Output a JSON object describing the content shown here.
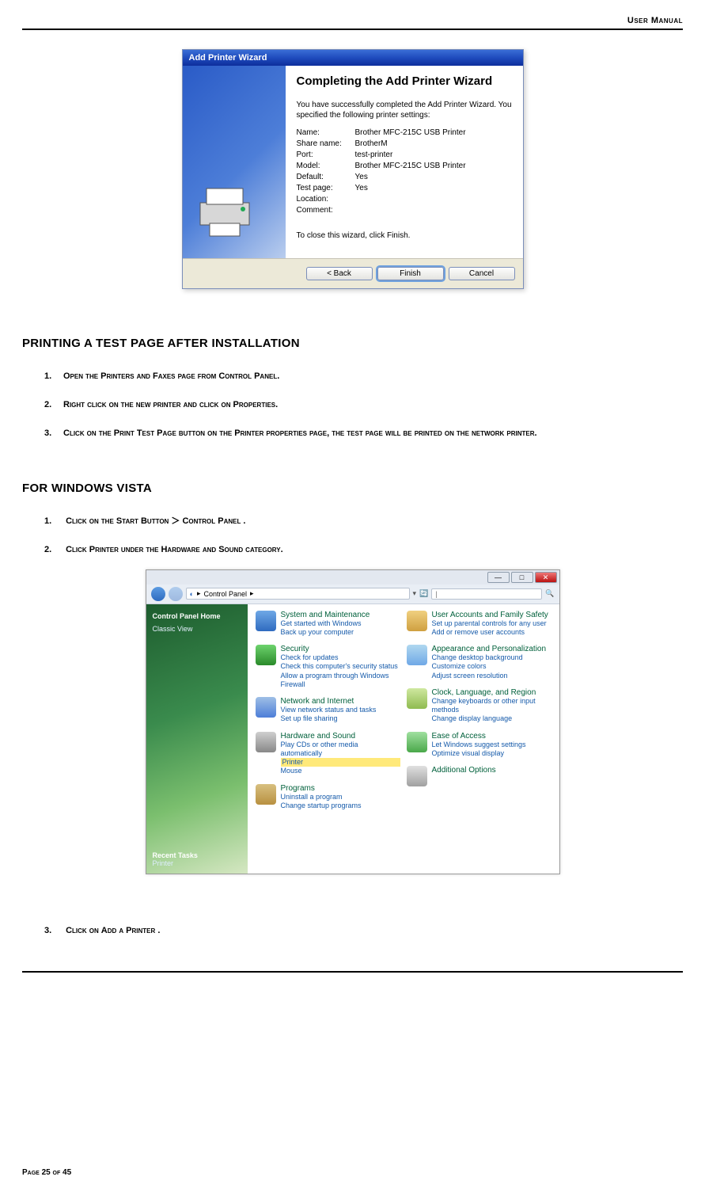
{
  "doc": {
    "header_right": "User Manual",
    "footer": "Page 25 of 45"
  },
  "wizard": {
    "title": "Add Printer Wizard",
    "heading": "Completing the Add Printer Wizard",
    "intro": "You have successfully completed the Add Printer Wizard. You specified the following printer settings:",
    "rows": {
      "name_l": "Name:",
      "name_v": "Brother MFC-215C USB Printer",
      "share_l": "Share name:",
      "share_v": "BrotherM",
      "port_l": "Port:",
      "port_v": "test-printer",
      "model_l": "Model:",
      "model_v": "Brother MFC-215C USB Printer",
      "default_l": "Default:",
      "default_v": "Yes",
      "test_l": "Test page:",
      "test_v": "Yes",
      "loc_l": "Location:",
      "loc_v": "",
      "comment_l": "Comment:",
      "comment_v": ""
    },
    "close_hint": "To close this wizard, click Finish.",
    "buttons": {
      "back": "< Back",
      "finish": "Finish",
      "cancel": "Cancel"
    }
  },
  "section1": {
    "heading": "PRINTING A TEST PAGE AFTER INSTALLATION",
    "steps": [
      "Open the Printers and Faxes page from Control Panel.",
      "Right click on the new printer and click on Properties.",
      "Click on the Print Test Page button on the Printer properties page, the test page will be printed on the network printer."
    ]
  },
  "section2": {
    "heading": "FOR WINDOWS VISTA",
    "step1_pre": "Click on the ",
    "step1_b1": "Start Button",
    "step1_sep": "＞ ",
    "step1_b2": "Control Panel",
    "step1_post": ".",
    "step2_pre": "Click ",
    "step2_b1": "Printer",
    "step2_mid": " under the ",
    "step2_b2": "Hardware and Sound",
    "step2_post": " category.",
    "step3_pre": "Click on ",
    "step3_b": "Add a Printer",
    "step3_post": "."
  },
  "vista": {
    "breadcrumb_icon": "▸",
    "breadcrumb": "Control Panel",
    "search_placeholder": "|",
    "side": {
      "home": "Control Panel Home",
      "classic": "Classic View",
      "recent": "Recent Tasks",
      "printer": "Printer"
    },
    "cats": {
      "sys": {
        "title": "System and Maintenance",
        "l1": "Get started with Windows",
        "l2": "Back up your computer"
      },
      "sec": {
        "title": "Security",
        "l1": "Check for updates",
        "l2": "Check this computer's security status",
        "l3": "Allow a program through Windows Firewall"
      },
      "net": {
        "title": "Network and Internet",
        "l1": "View network status and tasks",
        "l2": "Set up file sharing"
      },
      "hw": {
        "title": "Hardware and Sound",
        "l1": "Play CDs or other media automatically",
        "l2": "Printer",
        "l3": "Mouse"
      },
      "prog": {
        "title": "Programs",
        "l1": "Uninstall a program",
        "l2": "Change startup programs"
      },
      "user": {
        "title": "User Accounts and Family Safety",
        "l1": "Set up parental controls for any user",
        "l2": "Add or remove user accounts"
      },
      "appr": {
        "title": "Appearance and Personalization",
        "l1": "Change desktop background",
        "l2": "Customize colors",
        "l3": "Adjust screen resolution"
      },
      "clock": {
        "title": "Clock, Language, and Region",
        "l1": "Change keyboards or other input methods",
        "l2": "Change display language"
      },
      "ease": {
        "title": "Ease of Access",
        "l1": "Let Windows suggest settings",
        "l2": "Optimize visual display"
      },
      "add": {
        "title": "Additional Options"
      }
    }
  }
}
